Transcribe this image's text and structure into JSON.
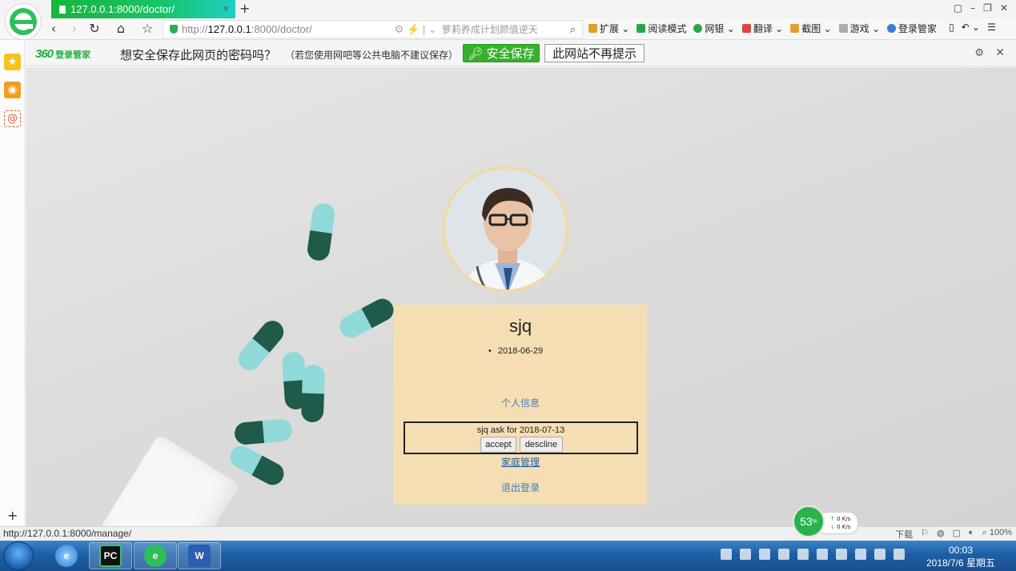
{
  "browser": {
    "tab_title": "127.0.0.1:8000/doctor/",
    "tab_close": "×",
    "new_tab": "+",
    "window_controls": [
      "▢",
      "–",
      "❐",
      "✕"
    ],
    "url": {
      "protocol": "http://",
      "host": "127.0.0.1",
      "path": ":8000/doctor/"
    },
    "search_placeholder": "萝莉养成计划颜值逆天",
    "toolbar": [
      {
        "label": "扩展",
        "icon": "extensions-icon",
        "color": "#e2a02c"
      },
      {
        "label": "阅读模式",
        "icon": "read-mode-icon",
        "color": "#2aa64a"
      },
      {
        "label": "网银",
        "icon": "bank-icon",
        "color": "#2aa64a"
      },
      {
        "label": "翻译",
        "icon": "translate-icon",
        "color": "#d44"
      },
      {
        "label": "截图",
        "icon": "screenshot-icon",
        "color": "#e2a02c"
      },
      {
        "label": "游戏",
        "icon": "game-icon",
        "color": "#888"
      },
      {
        "label": "登录管家",
        "icon": "login-manager-icon",
        "color": "#3a7bd5"
      }
    ]
  },
  "password_bar": {
    "brand_logo": "360",
    "brand_text": "登录管家",
    "question": "想安全保存此网页的密码吗？",
    "note": "（若您使用网吧等公共电脑不建议保存）",
    "save_label": "安全保存",
    "never_label": "此网站不再提示"
  },
  "profile": {
    "name": "sjq",
    "date": "2018-06-29",
    "link_personal": "个人信息",
    "request_text": "sjq ask for 2018-07-13",
    "accept_label": "accept",
    "decline_label": "descline",
    "link_family": "家庭管理",
    "link_logout": "退出登录"
  },
  "status": {
    "hover_url": "http://127.0.0.1:8000/manage/",
    "download_label": "下载",
    "zoom": "100%"
  },
  "speed_widget": {
    "percent": "53",
    "percent_unit": "%",
    "up": "0 K/s",
    "down": "0 K/s"
  },
  "taskbar": {
    "time": "00:03",
    "date": "2018/7/6 星期五"
  }
}
